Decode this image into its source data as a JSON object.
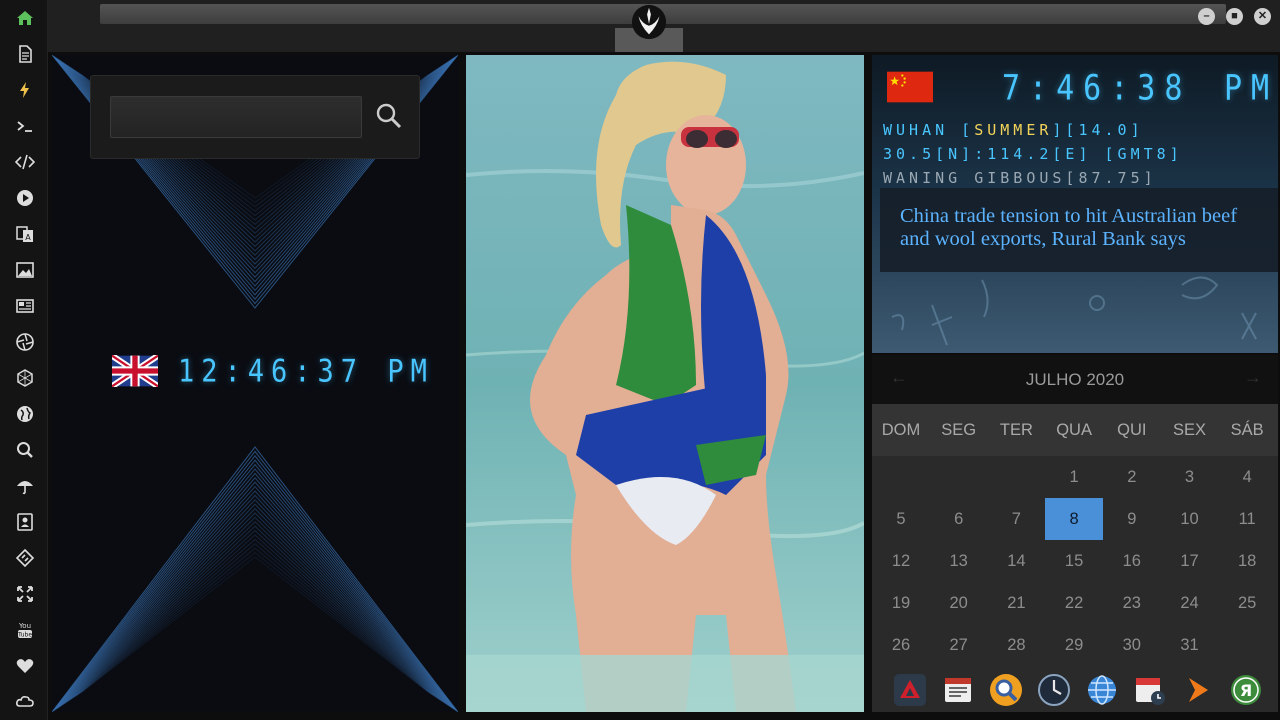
{
  "app": {
    "sidebar_icons": [
      "home-icon",
      "document-icon",
      "lightning-icon",
      "terminal-icon",
      "code-icon",
      "play-icon",
      "translate-icon",
      "image-icon",
      "newspaper-icon",
      "aperture-icon",
      "hexagon-icon",
      "globe-icon",
      "search-icon",
      "umbrella-icon",
      "contacts-icon",
      "tag-icon",
      "expand-icon",
      "youtube-icon",
      "heart-icon",
      "cloud-icon"
    ],
    "youtube_label": "You Tube"
  },
  "search": {
    "value": "",
    "placeholder": ""
  },
  "uk_clock": {
    "time": "12:46:37",
    "ampm": "PM"
  },
  "china_clock": {
    "time": "7:46:38",
    "ampm": "PM",
    "city": "WUHAN",
    "season": "SUMMER",
    "temp": "14.0",
    "coords": "30.5[N]:114.2[E] [GMT8]",
    "moon": "WANING GIBBOUS[87.75]"
  },
  "news": {
    "headline": "China trade tension to hit Australian beef and wool exports, Rural Bank says"
  },
  "calendar": {
    "title": "JULHO 2020",
    "weekdays": [
      "DOM",
      "SEG",
      "TER",
      "QUA",
      "QUI",
      "SEX",
      "SÁB"
    ],
    "weeks": [
      [
        "",
        "",
        "",
        "1",
        "2",
        "3",
        "4"
      ],
      [
        "5",
        "6",
        "7",
        "8",
        "9",
        "10",
        "11"
      ],
      [
        "12",
        "13",
        "14",
        "15",
        "16",
        "17",
        "18"
      ],
      [
        "19",
        "20",
        "21",
        "22",
        "23",
        "24",
        "25"
      ],
      [
        "26",
        "27",
        "28",
        "29",
        "30",
        "31",
        ""
      ]
    ],
    "selected": "8"
  },
  "dock_icons": [
    "red-triangle-app-icon",
    "calendar-news-icon",
    "magnifier-app-icon",
    "clock-app-icon",
    "globe-app-icon",
    "calendar-clock-icon",
    "arrow-app-icon",
    "yandex-icon"
  ],
  "colors": {
    "digital": "#49c5ff",
    "highlight": "#f2d35a",
    "headline": "#5cb3ff",
    "selected_day": "#4a90d9"
  }
}
